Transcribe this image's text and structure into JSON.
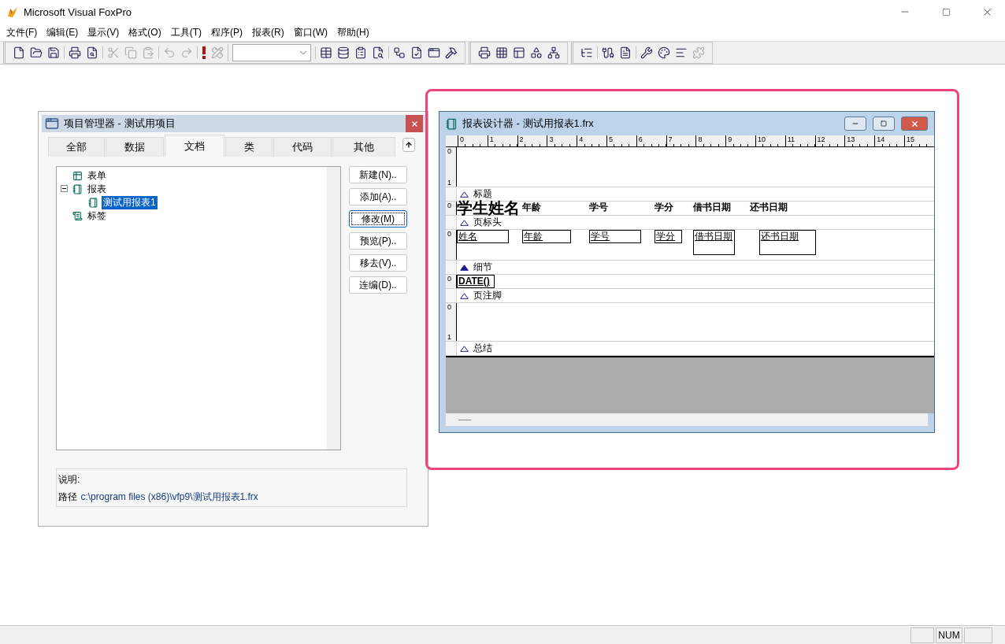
{
  "app": {
    "title": "Microsoft Visual FoxPro"
  },
  "menu": [
    "文件(F)",
    "编辑(E)",
    "显示(V)",
    "格式(O)",
    "工具(T)",
    "程序(P)",
    "报表(R)",
    "窗口(W)",
    "帮助(H)"
  ],
  "toolbars": [
    {
      "groups": [
        [
          {
            "kind": "button",
            "disabled": false
          },
          {
            "kind": "button",
            "disabled": false
          },
          {
            "kind": "button",
            "disabled": false
          }
        ],
        [
          {
            "kind": "button",
            "disabled": false
          },
          {
            "kind": "button",
            "disabled": false
          }
        ],
        [
          {
            "kind": "button",
            "disabled": true
          },
          {
            "kind": "button",
            "disabled": true
          },
          {
            "kind": "button",
            "disabled": true
          }
        ],
        [
          {
            "kind": "button",
            "disabled": true
          },
          {
            "kind": "button",
            "disabled": true
          }
        ],
        [
          {
            "kind": "button",
            "disabled": false
          },
          {
            "kind": "button",
            "disabled": true
          }
        ],
        [
          {
            "kind": "combo",
            "disabled": true
          }
        ],
        [
          {
            "kind": "button",
            "disabled": false
          },
          {
            "kind": "button",
            "disabled": false
          },
          {
            "kind": "button",
            "disabled": false
          },
          {
            "kind": "button",
            "disabled": false
          }
        ],
        [
          {
            "kind": "button",
            "disabled": false
          },
          {
            "kind": "button",
            "disabled": false
          },
          {
            "kind": "button",
            "disabled": false
          },
          {
            "kind": "button",
            "disabled": false
          }
        ]
      ]
    },
    {
      "groups": [
        [
          {
            "kind": "button",
            "disabled": false
          },
          {
            "kind": "button",
            "disabled": false
          },
          {
            "kind": "button",
            "disabled": false
          },
          {
            "kind": "button",
            "disabled": false
          },
          {
            "kind": "button",
            "disabled": false
          }
        ]
      ]
    },
    {
      "groups": [
        [
          {
            "kind": "button",
            "disabled": false
          }
        ],
        [
          {
            "kind": "button",
            "disabled": false
          },
          {
            "kind": "button",
            "disabled": false
          }
        ],
        [
          {
            "kind": "button",
            "disabled": false
          },
          {
            "kind": "button",
            "disabled": false
          },
          {
            "kind": "button",
            "disabled": false
          },
          {
            "kind": "button",
            "disabled": true
          }
        ]
      ]
    }
  ],
  "project_manager": {
    "title": "项目管理器 - 测试用项目",
    "tabs": [
      {
        "label": "全部",
        "selected": false
      },
      {
        "label": "数据",
        "selected": false
      },
      {
        "label": "文档",
        "selected": true
      },
      {
        "label": "类",
        "selected": false
      },
      {
        "label": "代码",
        "selected": false
      },
      {
        "label": "其他",
        "selected": false
      }
    ],
    "tree": [
      {
        "label": "表单",
        "kind": "form",
        "selected": false
      },
      {
        "label": "报表",
        "kind": "report",
        "selected": false,
        "expanded": true,
        "children": [
          {
            "label": "测试用报表1",
            "kind": "report",
            "selected": true
          }
        ]
      },
      {
        "label": "标签",
        "kind": "label",
        "selected": false
      }
    ],
    "buttons": [
      {
        "label": "新建(N)..",
        "focused": false
      },
      {
        "label": "添加(A)..",
        "focused": false
      },
      {
        "label": "修改(M)",
        "focused": true
      },
      {
        "label": "预览(P)..",
        "focused": false
      },
      {
        "label": "移去(V)..",
        "focused": false
      },
      {
        "label": "连编(D)..",
        "focused": false
      }
    ],
    "description": {
      "label": "说明:",
      "path_label": "路径",
      "path": "c:\\program files (x86)\\vfp9\\测试用报表1.frx"
    }
  },
  "report_designer": {
    "title": "报表设计器 - 测试用报表1.frx",
    "ruler": [
      "0",
      "1",
      "2",
      "3",
      "4",
      "5",
      "6",
      "7",
      "8",
      "9",
      "10",
      "11",
      "12",
      "13",
      "14",
      "15"
    ],
    "bands": [
      {
        "label": "标题",
        "active": false,
        "ruler": [
          "0",
          "1"
        ]
      },
      {
        "label": "页标头",
        "active": false,
        "ruler": [
          "0"
        ],
        "controls": [
          {
            "kind": "big-label",
            "text": "学生姓名"
          },
          {
            "kind": "label",
            "text": "年龄"
          },
          {
            "kind": "label",
            "text": "学号"
          },
          {
            "kind": "label",
            "text": "学分"
          },
          {
            "kind": "label",
            "text": "借书日期"
          },
          {
            "kind": "label",
            "text": "还书日期"
          }
        ]
      },
      {
        "label": "细节",
        "active": true,
        "ruler": [
          "0"
        ],
        "controls": [
          {
            "kind": "field",
            "text": "姓名"
          },
          {
            "kind": "field",
            "text": "年龄"
          },
          {
            "kind": "field",
            "text": "学号"
          },
          {
            "kind": "field",
            "text": "学分"
          },
          {
            "kind": "tall-field",
            "text": "借书日期"
          },
          {
            "kind": "tall-field",
            "text": "还书日期"
          }
        ]
      },
      {
        "label": "页注脚",
        "active": false,
        "ruler": [
          "0"
        ],
        "controls": [
          {
            "kind": "bold-field",
            "text": "DATE()"
          }
        ]
      },
      {
        "label": "总结",
        "active": false,
        "ruler": [
          "0",
          "1"
        ]
      }
    ]
  },
  "status_bar": {
    "indicators": [
      "NUM"
    ]
  }
}
